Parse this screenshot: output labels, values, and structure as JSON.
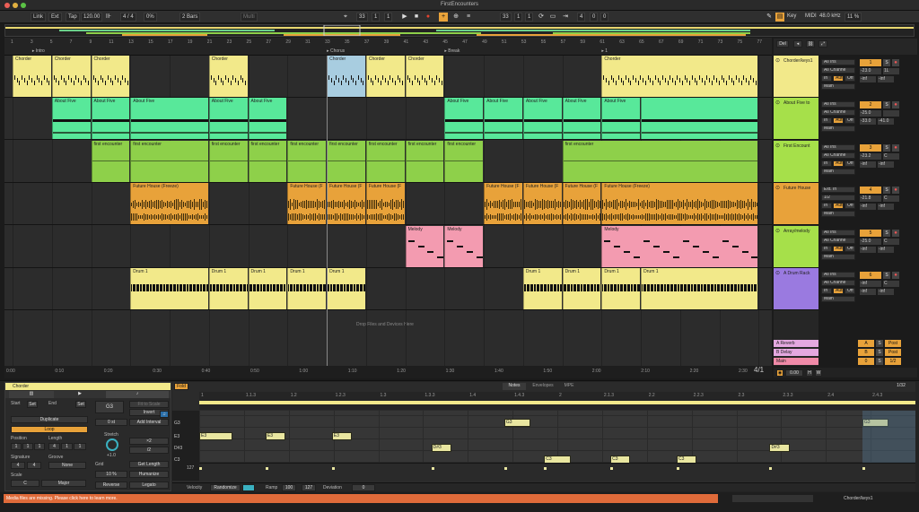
{
  "window": {
    "title": "FirstEncounters"
  },
  "control": {
    "link": "Link",
    "ext": "Ext",
    "tap": "Tap",
    "tempo": "120.00",
    "signature": "4 / 4",
    "cpu": "0%",
    "quantize": "2 Bars",
    "mode": "Multi",
    "position": [
      "33",
      "1",
      "1"
    ],
    "loop_start": [
      "33",
      "1",
      "1"
    ],
    "loop_length": [
      "4",
      "0",
      "0"
    ],
    "key": "Key",
    "midi": "MIDI",
    "sample_rate": "48.0 kHz",
    "cpu_load": "11 %",
    "colors": {
      "accent": "#e8a23a",
      "record": "#e5432f",
      "play": "#dddddd"
    }
  },
  "ruler": {
    "bars": [
      "1",
      "3",
      "5",
      "7",
      "9",
      "11",
      "13",
      "15",
      "17",
      "19",
      "21",
      "23",
      "25",
      "27",
      "29",
      "31",
      "33",
      "35",
      "37",
      "39",
      "41",
      "43",
      "45",
      "47",
      "49",
      "51",
      "53",
      "55",
      "57",
      "59",
      "61",
      "63",
      "65",
      "67",
      "69",
      "71",
      "73",
      "75",
      "77"
    ],
    "locators": [
      {
        "label": "Intro"
      },
      {
        "label": "Chorus"
      },
      {
        "label": "Break"
      },
      {
        "label": "1"
      }
    ]
  },
  "arrangement": {
    "drop_hint": "Drop Files and Devices Here",
    "time": [
      "0:00",
      "0:10",
      "0:20",
      "0:30",
      "0:40",
      "0:50",
      "1:00",
      "1:10",
      "1:20",
      "1:30",
      "1:40",
      "1:50",
      "2:00",
      "2:10",
      "2:20",
      "2:30"
    ],
    "zoom": "4/1",
    "tracks": [
      {
        "id": "chorder",
        "name": "Chorder/keys1",
        "num": "1",
        "color": "#f2e98a",
        "input": "All Ins",
        "channel": "All Channe",
        "vol": "-23.0",
        "pan": "1L",
        "send": "-inf",
        "sendb": "-inf",
        "clips": [
          {
            "bar": 1,
            "len": 4,
            "name": "Chorder",
            "color": "#f2e98a"
          },
          {
            "bar": 5,
            "len": 4,
            "name": "Chorder",
            "color": "#f2e98a"
          },
          {
            "bar": 9,
            "len": 4,
            "name": "Chorder",
            "color": "#f2e98a"
          },
          {
            "bar": 21,
            "len": 4,
            "name": "Chorder",
            "color": "#f2e98a"
          },
          {
            "bar": 33,
            "len": 4,
            "name": "Chorder",
            "color": "#a8cde0"
          },
          {
            "bar": 37,
            "len": 4,
            "name": "Chorder",
            "color": "#f2e98a"
          },
          {
            "bar": 41,
            "len": 4,
            "name": "Chorder",
            "color": "#f2e98a"
          },
          {
            "bar": 61,
            "len": 16,
            "name": "Chorder",
            "color": "#f2e98a"
          }
        ]
      },
      {
        "id": "about",
        "name": "About Five to",
        "num": "2",
        "color": "#a6e04a",
        "input": "All Ins",
        "channel": "All Channe",
        "vol": "-25.0",
        "pan": "",
        "send": "-33.0",
        "sendb": "-41.0",
        "clips": [
          {
            "bar": 5,
            "len": 4,
            "name": "About Five",
            "color": "#58e89a"
          },
          {
            "bar": 9,
            "len": 4,
            "name": "About Five",
            "color": "#58e89a"
          },
          {
            "bar": 13,
            "len": 8,
            "name": "About Five",
            "color": "#58e89a"
          },
          {
            "bar": 21,
            "len": 4,
            "name": "About Five",
            "color": "#58e89a"
          },
          {
            "bar": 25,
            "len": 4,
            "name": "About Five",
            "color": "#58e89a"
          },
          {
            "bar": 45,
            "len": 4,
            "name": "About Five",
            "color": "#58e89a"
          },
          {
            "bar": 49,
            "len": 4,
            "name": "About Five",
            "color": "#58e89a"
          },
          {
            "bar": 53,
            "len": 4,
            "name": "About Five",
            "color": "#58e89a"
          },
          {
            "bar": 57,
            "len": 4,
            "name": "About Five",
            "color": "#58e89a"
          },
          {
            "bar": 61,
            "len": 4,
            "name": "About Five",
            "color": "#58e89a"
          },
          {
            "bar": 65,
            "len": 12,
            "name": "",
            "color": "#58e89a"
          }
        ]
      },
      {
        "id": "first",
        "name": "First Encount",
        "num": "3",
        "color": "#a6e04a",
        "input": "All Ins",
        "channel": "All Channe",
        "vol": "-23.2",
        "pan": "C",
        "send": "-inf",
        "sendb": "-inf",
        "clips": [
          {
            "bar": 9,
            "len": 4,
            "name": "first encounter",
            "color": "#8ed04a"
          },
          {
            "bar": 13,
            "len": 8,
            "name": "first encounter",
            "color": "#8ed04a"
          },
          {
            "bar": 21,
            "len": 4,
            "name": "first encounter",
            "color": "#8ed04a"
          },
          {
            "bar": 25,
            "len": 4,
            "name": "first encounter",
            "color": "#8ed04a"
          },
          {
            "bar": 29,
            "len": 4,
            "name": "first encounter",
            "color": "#8ed04a"
          },
          {
            "bar": 33,
            "len": 4,
            "name": "first encounter",
            "color": "#8ed04a"
          },
          {
            "bar": 37,
            "len": 4,
            "name": "first encounter",
            "color": "#8ed04a"
          },
          {
            "bar": 41,
            "len": 4,
            "name": "first encounter",
            "color": "#8ed04a"
          },
          {
            "bar": 45,
            "len": 4,
            "name": "first encounter",
            "color": "#8ed04a"
          },
          {
            "bar": 57,
            "len": 20,
            "name": "first encounter",
            "color": "#8ed04a"
          }
        ]
      },
      {
        "id": "future",
        "name": "Future House",
        "num": "4",
        "color": "#e8a23a",
        "input": "Ext. In",
        "channel": "1/2",
        "vol": "-21.8",
        "pan": "C",
        "send": "-inf",
        "sendb": "-inf",
        "clips": [
          {
            "bar": 13,
            "len": 8,
            "name": "Future House (Freeze)",
            "color": "#e8a23a"
          },
          {
            "bar": 29,
            "len": 4,
            "name": "Future House (F",
            "color": "#e8a23a"
          },
          {
            "bar": 33,
            "len": 4,
            "name": "Future House (F",
            "color": "#e8a23a"
          },
          {
            "bar": 37,
            "len": 4,
            "name": "Future House (F",
            "color": "#e8a23a"
          },
          {
            "bar": 49,
            "len": 4,
            "name": "Future House (F",
            "color": "#e8a23a"
          },
          {
            "bar": 53,
            "len": 4,
            "name": "Future House (F",
            "color": "#e8a23a"
          },
          {
            "bar": 57,
            "len": 4,
            "name": "Future House (F",
            "color": "#e8a23a"
          },
          {
            "bar": 61,
            "len": 16,
            "name": "Future House (Freeze)",
            "color": "#e8a23a"
          }
        ]
      },
      {
        "id": "melody",
        "name": "Array/melody",
        "num": "5",
        "color": "#a6e04a",
        "input": "All Ins",
        "channel": "All Channe",
        "vol": "-25.0",
        "pan": "C",
        "send": "-inf",
        "sendb": "-inf",
        "clips": [
          {
            "bar": 41,
            "len": 4,
            "name": "Melody",
            "color": "#f39bb0"
          },
          {
            "bar": 45,
            "len": 4,
            "name": "Melody",
            "color": "#f39bb0"
          },
          {
            "bar": 61,
            "len": 16,
            "name": "Melody",
            "color": "#f39bb0"
          }
        ]
      },
      {
        "id": "drum",
        "name": "A Drum Rack",
        "num": "6",
        "color": "#9a7ae0",
        "input": "All Ins",
        "channel": "All Channe",
        "vol": "-inf",
        "pan": "C",
        "send": "-inf",
        "sendb": "-inf",
        "clips": [
          {
            "bar": 13,
            "len": 8,
            "name": "Drum 1",
            "color": "#f2e98a"
          },
          {
            "bar": 21,
            "len": 4,
            "name": "Drum 1",
            "color": "#f2e98a"
          },
          {
            "bar": 25,
            "len": 4,
            "name": "Drum 1",
            "color": "#f2e98a"
          },
          {
            "bar": 29,
            "len": 4,
            "name": "Drum 1",
            "color": "#f2e98a"
          },
          {
            "bar": 33,
            "len": 4,
            "name": "Drum 1",
            "color": "#f2e98a"
          },
          {
            "bar": 53,
            "len": 4,
            "name": "Drum 1",
            "color": "#f2e98a"
          },
          {
            "bar": 57,
            "len": 4,
            "name": "Drum 1",
            "color": "#f2e98a"
          },
          {
            "bar": 61,
            "len": 4,
            "name": "Drum 1",
            "color": "#f2e98a"
          },
          {
            "bar": 65,
            "len": 12,
            "name": "Drum 1",
            "color": "#f2e98a"
          }
        ]
      }
    ],
    "returns": [
      {
        "name": "A Reverb",
        "letter": "A",
        "color": "#e4a8e0",
        "post": "Post"
      },
      {
        "name": "B Delay",
        "letter": "B",
        "color": "#e4a8e0",
        "post": "Post"
      },
      {
        "name": "Main",
        "letter": "0",
        "color": "#f08aa8",
        "post": "1/2"
      }
    ],
    "header_buttons": {
      "del": "Del"
    },
    "cue": "0.00"
  },
  "clip_panel": {
    "title": "Chorder",
    "start": "Start",
    "end": "End",
    "set": "Set",
    "duplicate": "Duplicate",
    "loop": "Loop",
    "position": "Position",
    "length": "Length",
    "pos_vals": [
      "1",
      "1",
      "1"
    ],
    "len_vals": [
      "4",
      "1",
      "1"
    ],
    "signature": "Signature",
    "groove": "Groove",
    "sig_vals": [
      "4",
      "4"
    ],
    "groove_val": "None",
    "scale": "Scale",
    "root": "C",
    "scale_mode": "Major",
    "note": "G3",
    "fit": "Fit to Scale",
    "invert": "Invert",
    "st": "0 st",
    "add_interval": "Add Interval",
    "stretch": "Stretch",
    "stretch_val": "+1.0",
    "x2": "×2",
    "div2": "/2",
    "grid": "Grid",
    "grid_val": "1/16",
    "get_length": "Get Length",
    "percent": "10 %",
    "humanize": "Humanize",
    "reverse": "Reverse",
    "legato": "Legato"
  },
  "editor": {
    "fold": "Fold",
    "tabs": [
      "Notes",
      "Envelopes",
      "MPE"
    ],
    "grid_div": "1/32",
    "keys": [
      "G3",
      "E3",
      "D#3",
      "C3"
    ],
    "bars": [
      "1",
      "1.1.3",
      "1.2",
      "1.2.3",
      "1.3",
      "1.3.3",
      "1.4",
      "1.4.3",
      "2",
      "2.1.3",
      "2.2",
      "2.2.3",
      "2.3",
      "2.3.3",
      "2.4",
      "2.4.3"
    ],
    "notes": [
      {
        "label": "E3",
        "row": 1,
        "start": 0,
        "len": 2.5
      },
      {
        "label": "E3",
        "row": 1,
        "start": 5,
        "len": 1.5
      },
      {
        "label": "E3",
        "row": 1,
        "start": 10,
        "len": 1.5
      },
      {
        "label": "D#3",
        "row": 2,
        "start": 17.5,
        "len": 1.5
      },
      {
        "label": "G3",
        "row": 0,
        "start": 23,
        "len": 2
      },
      {
        "label": "C3",
        "row": 3,
        "start": 26,
        "len": 2
      },
      {
        "label": "C3",
        "row": 3,
        "start": 31,
        "len": 1.5
      },
      {
        "label": "C3",
        "row": 3,
        "start": 36,
        "len": 1.5
      },
      {
        "label": "D#3",
        "row": 2,
        "start": 43,
        "len": 1.5
      },
      {
        "label": "G3",
        "row": 0,
        "start": 50,
        "len": 2
      }
    ],
    "vel_max": "127",
    "velocity": "Velocity",
    "randomize": "Randomize",
    "ramp": "Ramp",
    "ramp_a": "100",
    "ramp_b": "127",
    "deviation": "Deviation",
    "dev_val": "0"
  },
  "status": {
    "message": "Media files are missing. Please click here to learn more.",
    "track": "Chorder/keys1"
  }
}
